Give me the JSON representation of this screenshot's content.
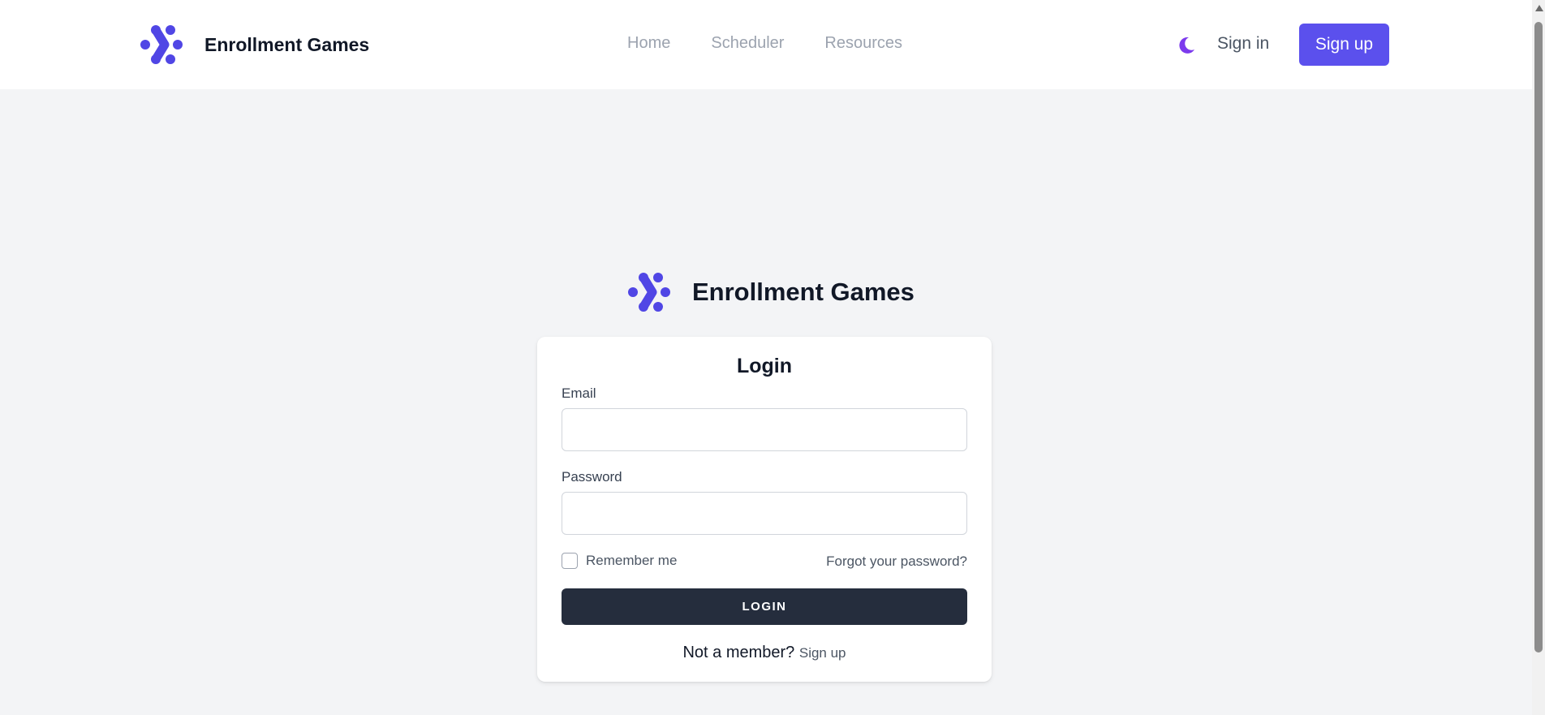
{
  "header": {
    "brand_name": "Enrollment Games",
    "nav": [
      {
        "label": "Home"
      },
      {
        "label": "Scheduler"
      },
      {
        "label": "Resources"
      }
    ],
    "theme_icon": "moon-icon",
    "signin_label": "Sign in",
    "signup_label": "Sign up"
  },
  "main": {
    "brand_name": "Enrollment Games",
    "login_form": {
      "title": "Login",
      "email_label": "Email",
      "email_value": "",
      "password_label": "Password",
      "password_value": "",
      "remember_label": "Remember me",
      "remember_checked": false,
      "forgot_label": "Forgot your password?",
      "submit_label": "LOGIN",
      "member_text": "Not a member?",
      "member_link": "Sign up"
    }
  },
  "colors": {
    "accent": "#5b50ed",
    "logo": "#5046e5",
    "moon": "#7c3aed",
    "login_button": "#252d3d",
    "background": "#f3f4f6"
  }
}
